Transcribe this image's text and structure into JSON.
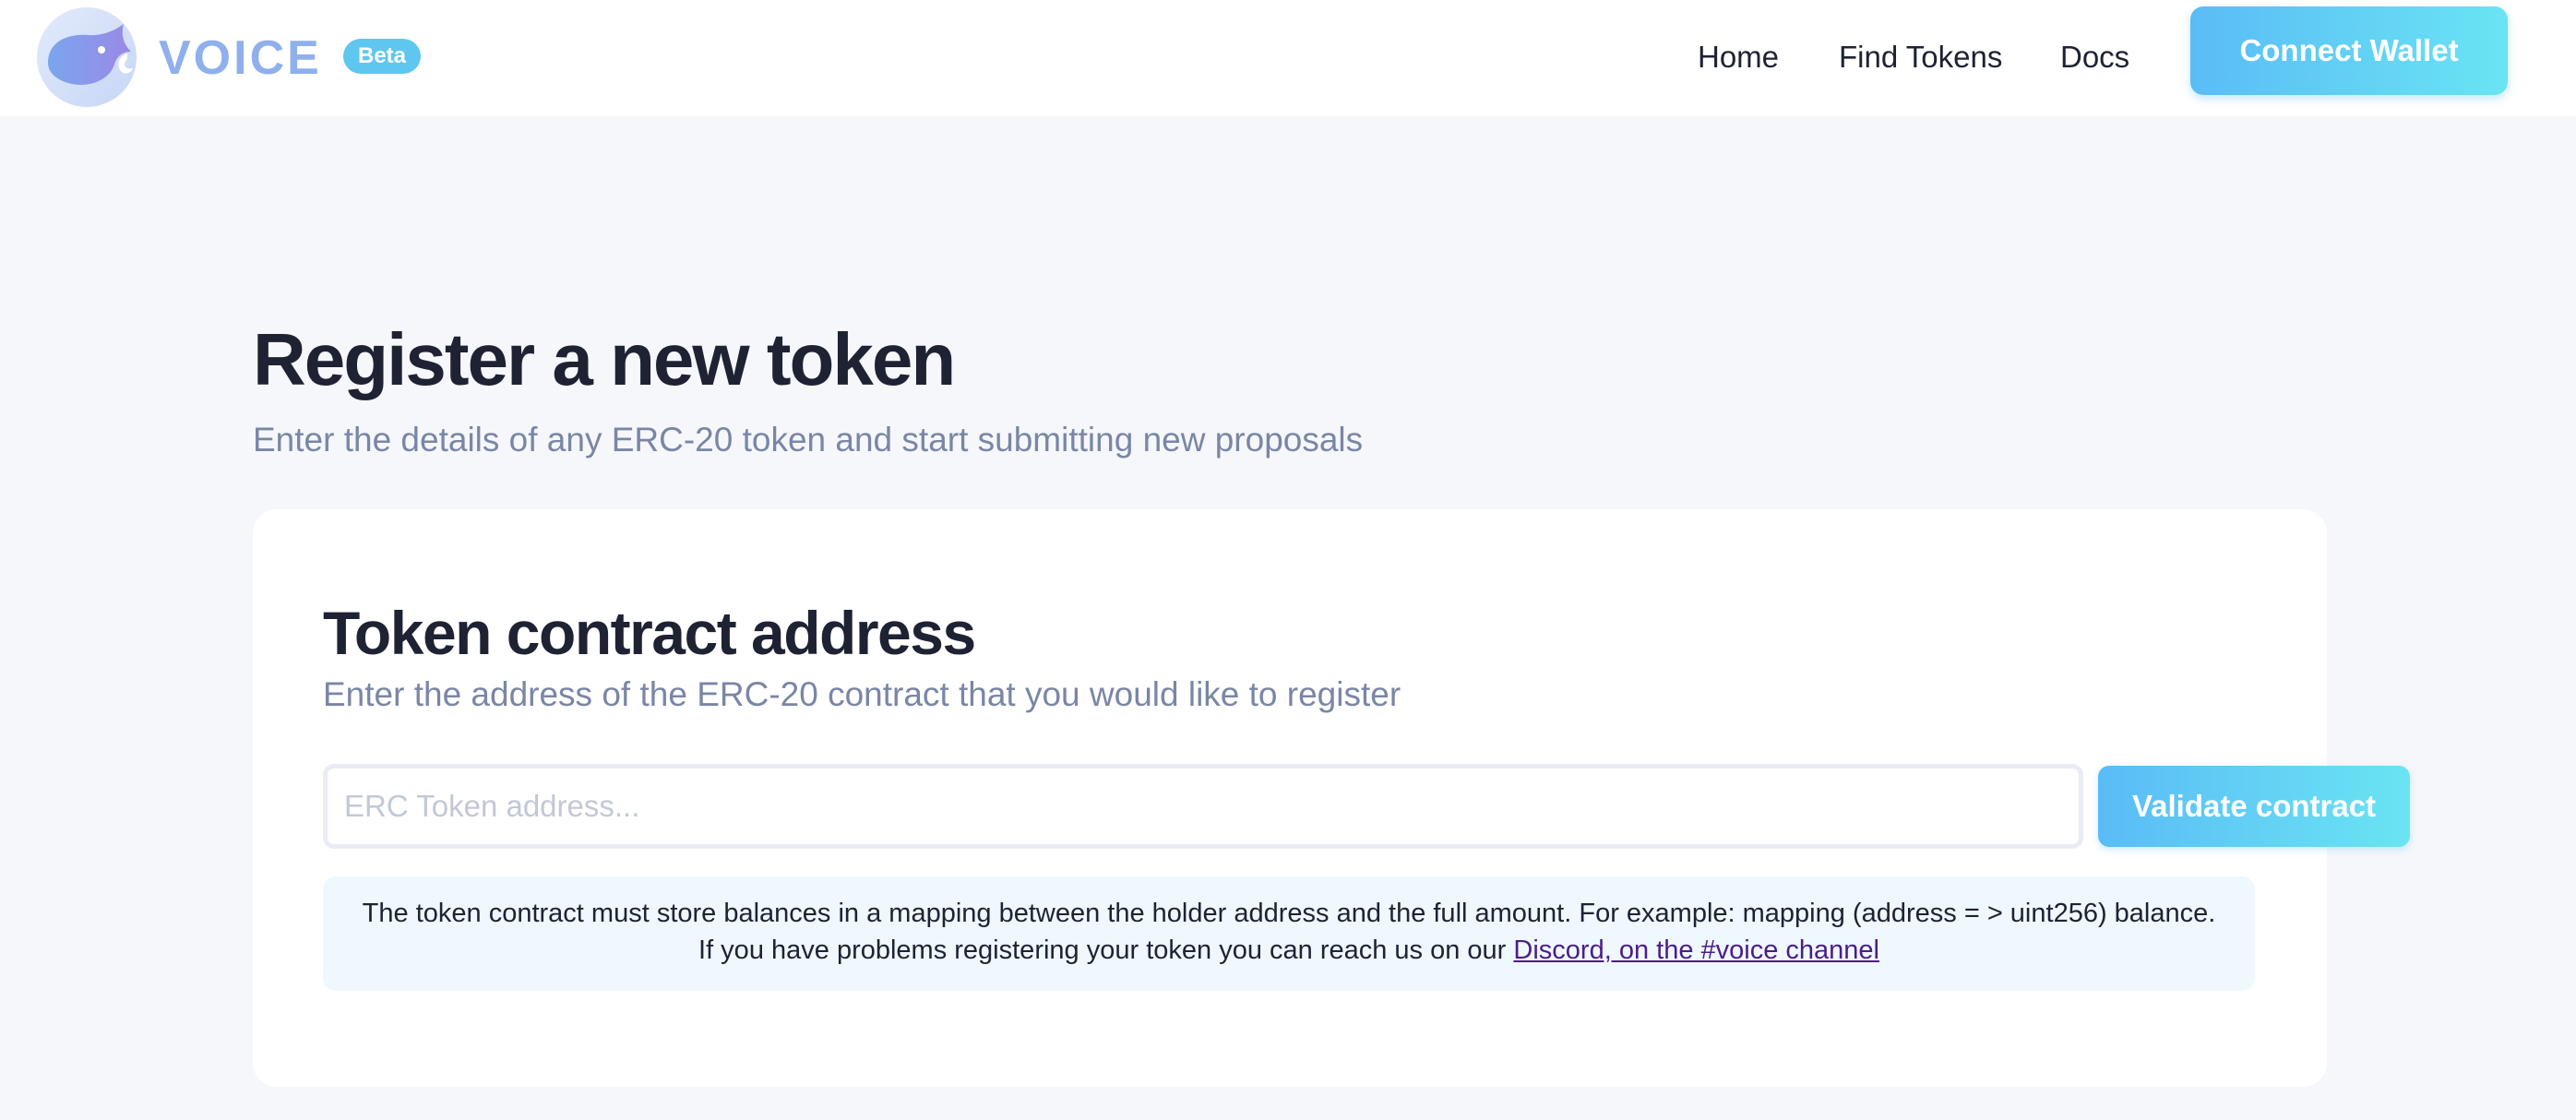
{
  "header": {
    "brand": "VOICE",
    "badge": "Beta",
    "nav": {
      "home": "Home",
      "find_tokens": "Find Tokens",
      "docs": "Docs"
    },
    "connect_label": "Connect Wallet"
  },
  "page": {
    "title": "Register a new token",
    "subtitle": "Enter the details of any ERC-20 token and start submitting new proposals"
  },
  "card": {
    "title": "Token contract address",
    "subtitle": "Enter the address of the ERC-20 contract that you would like to register",
    "input": {
      "value": "",
      "placeholder": "ERC Token address..."
    },
    "validate_label": "Validate contract",
    "info": {
      "line1": "The token contract must store balances in a mapping between the holder address and the full amount. For example: mapping (address = > uint256) balance.",
      "line2_prefix": "If you have problems registering your token you can reach us on our ",
      "link_text": "Discord, on the #voice channel"
    }
  },
  "colors": {
    "accent_start": "#5abcf6",
    "accent_end": "#6ae4f3",
    "badge": "#5ec7ef",
    "brand_text": "#8fb0ec",
    "link": "#4b1d8a",
    "info_bg": "#eef8fd",
    "page_bg": "#f5f7fa"
  },
  "icons": {
    "logo": "voice-cat-logo-icon"
  }
}
